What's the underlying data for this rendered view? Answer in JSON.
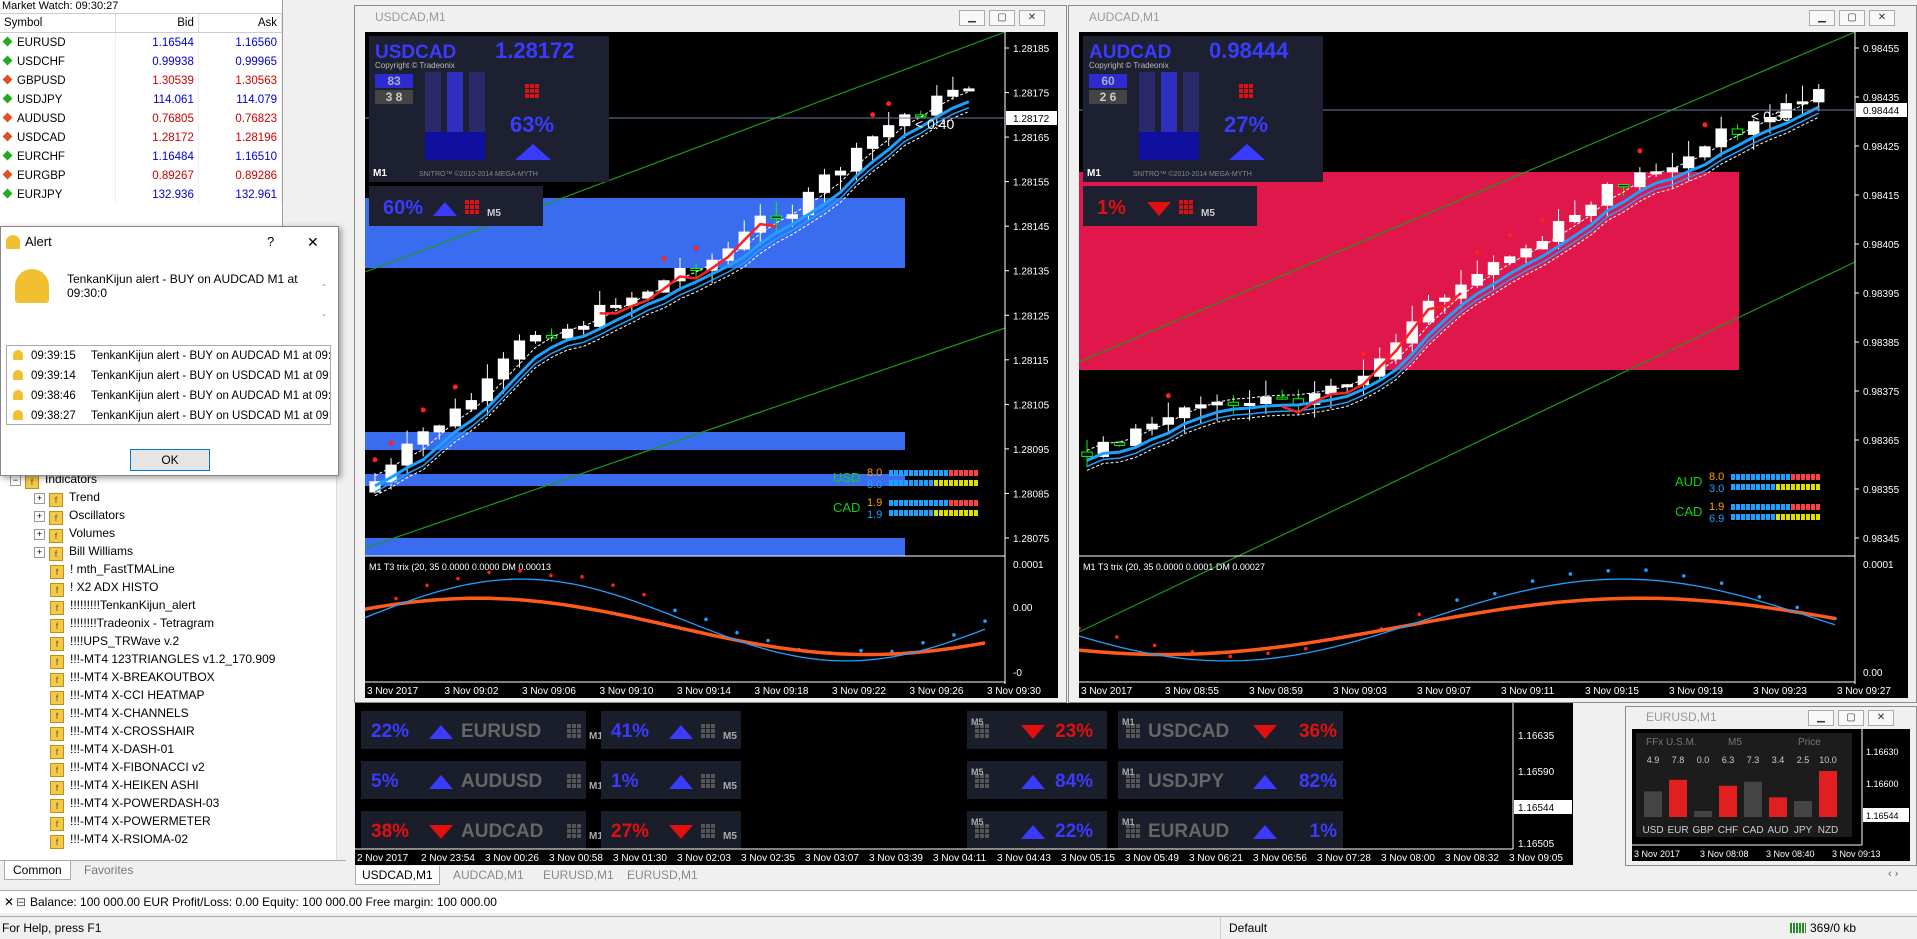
{
  "market_watch": {
    "title": "Market Watch: 09:30:27",
    "headers": {
      "symbol": "Symbol",
      "bid": "Bid",
      "ask": "Ask"
    },
    "rows": [
      {
        "symbol": "EURUSD",
        "bid": "1.16544",
        "ask": "1.16560",
        "dir": "up"
      },
      {
        "symbol": "USDCHF",
        "bid": "0.99938",
        "ask": "0.99965",
        "dir": "up"
      },
      {
        "symbol": "GBPUSD",
        "bid": "1.30539",
        "ask": "1.30563",
        "dir": "dn"
      },
      {
        "symbol": "USDJPY",
        "bid": "114.061",
        "ask": "114.079",
        "dir": "up"
      },
      {
        "symbol": "AUDUSD",
        "bid": "0.76805",
        "ask": "0.76823",
        "dir": "dn"
      },
      {
        "symbol": "USDCAD",
        "bid": "1.28172",
        "ask": "1.28196",
        "dir": "dn"
      },
      {
        "symbol": "EURCHF",
        "bid": "1.16484",
        "ask": "1.16510",
        "dir": "up"
      },
      {
        "symbol": "EURGBP",
        "bid": "0.89267",
        "ask": "0.89286",
        "dir": "dn"
      },
      {
        "symbol": "EURJPY",
        "bid": "132.936",
        "ask": "132.961",
        "dir": "up"
      }
    ]
  },
  "alert": {
    "title": "Alert",
    "help": "?",
    "close": "✕",
    "message": "TenkanKijun alert - BUY on AUDCAD M1 at 09:30:0",
    "history": [
      {
        "time": "09:39:15",
        "text": "TenkanKijun alert - BUY on AUDCAD M1 at 09:..."
      },
      {
        "time": "09:39:14",
        "text": "TenkanKijun alert - BUY on USDCAD M1 at 09:..."
      },
      {
        "time": "09:38:46",
        "text": "TenkanKijun alert - BUY on AUDCAD M1 at 09:..."
      },
      {
        "time": "09:38:27",
        "text": "TenkanKijun alert - BUY on USDCAD M1 at 09:..."
      }
    ],
    "ok": "OK"
  },
  "navigator": {
    "root": "Indicators",
    "groups": [
      "Trend",
      "Oscillators",
      "Volumes",
      "Bill Williams"
    ],
    "items": [
      "!   mth_FastTMALine",
      "!  X2 ADX HISTO",
      "!!!!!!!!!TenkanKijun_alert",
      "!!!!!!!!Tradeonix - Tetragram",
      "!!!!UPS_TRWave v.2",
      "!!!-MT4 123TRIANGLES v1.2_170.909",
      "!!!-MT4 X-BREAKOUTBOX",
      "!!!-MT4 X-CCI HEATMAP",
      "!!!-MT4 X-CHANNELS",
      "!!!-MT4 X-CROSSHAIR",
      "!!!-MT4 X-DASH-01",
      "!!!-MT4 X-FIBONACCI v2",
      "!!!-MT4 X-HEIKEN ASHI",
      "!!!-MT4 X-POWERDASH-03",
      "!!!-MT4 X-POWERMETER",
      "!!!-MT4 X-RSIOMA-02"
    ],
    "tabs": [
      "Common",
      "Favorites"
    ]
  },
  "usdcad": {
    "window_title": "USDCAD,M1",
    "symbol": "USDCAD",
    "price": "1.28172",
    "copyright": "Copyright © Tradeonix",
    "meter_a": "83",
    "meter_b": "3 8",
    "pct": "63%",
    "tf_label": "M1",
    "footer": "SNITRO™ ©2010-2014 MEGA-MYTH",
    "badge_pct": "60%",
    "badge_tf": "M5",
    "timer": "< 0:40",
    "price_ticks": [
      "1.28185",
      "1.28175",
      "1.28165",
      "1.28155",
      "1.28145",
      "1.28135",
      "1.28125",
      "1.28115",
      "1.28105",
      "1.28095",
      "1.28085",
      "1.28075"
    ],
    "price_tag": "1.28172",
    "strength": [
      {
        "cur": "USD",
        "a": "8.0",
        "b": "8.0"
      },
      {
        "cur": "CAD",
        "a": "1.9",
        "b": "1.9"
      }
    ],
    "sub_label": "M1 T3 trix (20, 35 0.0000 0.0000  DM 0.00013",
    "sub_ticks": [
      "0.0001",
      "0.00",
      "-0"
    ],
    "time_ticks": [
      "3 Nov 2017",
      "3 Nov 09:02",
      "3 Nov 09:06",
      "3 Nov 09:10",
      "3 Nov 09:14",
      "3 Nov 09:18",
      "3 Nov 09:22",
      "3 Nov 09:26",
      "3 Nov 09:30"
    ]
  },
  "audcad": {
    "window_title": "AUDCAD,M1",
    "symbol": "AUDCAD",
    "price": "0.98444",
    "copyright": "Copyright © Tradeonix",
    "meter_a": "60",
    "meter_b": "2 6",
    "pct": "27%",
    "tf_label": "M1",
    "footer": "SNITRO™ ©2010-2014 MEGA-MYTH",
    "badge_pct": "1%",
    "badge_tf": "M5",
    "timer": "< 0:33",
    "price_ticks": [
      "0.98455",
      "0.98435",
      "0.98425",
      "0.98415",
      "0.98405",
      "0.98395",
      "0.98385",
      "0.98375",
      "0.98365",
      "0.98355",
      "0.98345"
    ],
    "price_tag": "0.98444",
    "strength": [
      {
        "cur": "AUD",
        "a": "8.0",
        "b": "3.0"
      },
      {
        "cur": "CAD",
        "a": "1.9",
        "b": "6.9"
      }
    ],
    "sub_label": "M1 T3 trix (20, 35 0.0000 0.0001  DM 0.00027",
    "sub_ticks": [
      "0.0001",
      "0.00"
    ],
    "time_ticks": [
      "3 Nov 2017",
      "3 Nov 08:55",
      "3 Nov 08:59",
      "3 Nov 09:03",
      "3 Nov 09:07",
      "3 Nov 09:11",
      "3 Nov 09:15",
      "3 Nov 09:19",
      "3 Nov 09:23",
      "3 Nov 09:27"
    ]
  },
  "eurusd_panel": {
    "badges_left": [
      {
        "pct": "22%",
        "dir": "up",
        "sym": "EURUSD",
        "tf": "M1",
        "pct2": "41%",
        "tf2": "M5"
      },
      {
        "pct": "5%",
        "dir": "up",
        "sym": "AUDUSD",
        "tf": "M1",
        "pct2": "1%",
        "tf2": "M5"
      },
      {
        "pct": "38%",
        "dir": "dn",
        "sym": "AUDCAD",
        "tf": "M1",
        "pct2": "27%",
        "tf2": "M5"
      }
    ],
    "badges_right": [
      {
        "tf2": "M5",
        "pct2": "23%",
        "dir2": "dn",
        "sym": "USDCAD",
        "tf": "M1",
        "pct": "36%",
        "dir": "dn"
      },
      {
        "tf2": "M5",
        "pct2": "84%",
        "dir2": "up",
        "sym": "USDJPY",
        "tf": "M1",
        "pct": "82%",
        "dir": "up"
      },
      {
        "tf2": "M5",
        "pct2": "22%",
        "dir2": "up",
        "sym": "EURAUD",
        "tf": "M1",
        "pct": "1%",
        "dir": "up"
      }
    ],
    "price_ticks": [
      "1.16635",
      "1.16590",
      "1.16544",
      "1.16505"
    ],
    "time_ticks": [
      "2 Nov 2017",
      "2 Nov 23:54",
      "3 Nov 00:26",
      "3 Nov 00:58",
      "3 Nov 01:30",
      "3 Nov 02:03",
      "3 Nov 02:35",
      "3 Nov 03:07",
      "3 Nov 03:39",
      "3 Nov 04:11",
      "3 Nov 04:43",
      "3 Nov 05:15",
      "3 Nov 05:49",
      "3 Nov 06:21",
      "3 Nov 06:56",
      "3 Nov 07:28",
      "3 Nov 08:00",
      "3 Nov 08:32",
      "3 Nov 09:05"
    ]
  },
  "eurusd_small": {
    "window_title": "EURUSD,M1",
    "header": [
      "FFx U.S.M.",
      "M5",
      "Price"
    ],
    "values": [
      "4.9",
      "7.8",
      "0.0",
      "6.3",
      "7.3",
      "3.4",
      "2.5",
      "10.0"
    ],
    "currencies": [
      "USD",
      "EUR",
      "GBP",
      "CHF",
      "CAD",
      "AUD",
      "JPY",
      "NZD"
    ],
    "price_ticks": [
      "1.16630",
      "1.16600",
      "1.16544"
    ],
    "price_tag": "1.16544",
    "time_ticks": [
      "3 Nov 2017",
      "3 Nov 08:08",
      "3 Nov 08:40",
      "3 Nov 09:13"
    ]
  },
  "chart_tabs": [
    "USDCAD,M1",
    "AUDCAD,M1",
    "EURUSD,M1",
    "EURUSD,M1"
  ],
  "terminal": {
    "text": "Balance: 100 000.00 EUR  Profit/Loss: 0.00  Equity: 100 000.00  Free margin: 100 000.00"
  },
  "status": {
    "help": "For Help, press F1",
    "profile": "Default",
    "traffic": "369/0 kb"
  },
  "colors": {
    "bull": "#ffffff",
    "bear": "#00ff00",
    "ma_fast": "#1ea0ff",
    "ma_red": "#ff2020",
    "zone_blue": "#3a6cf0",
    "zone_red": "#e0174a"
  }
}
